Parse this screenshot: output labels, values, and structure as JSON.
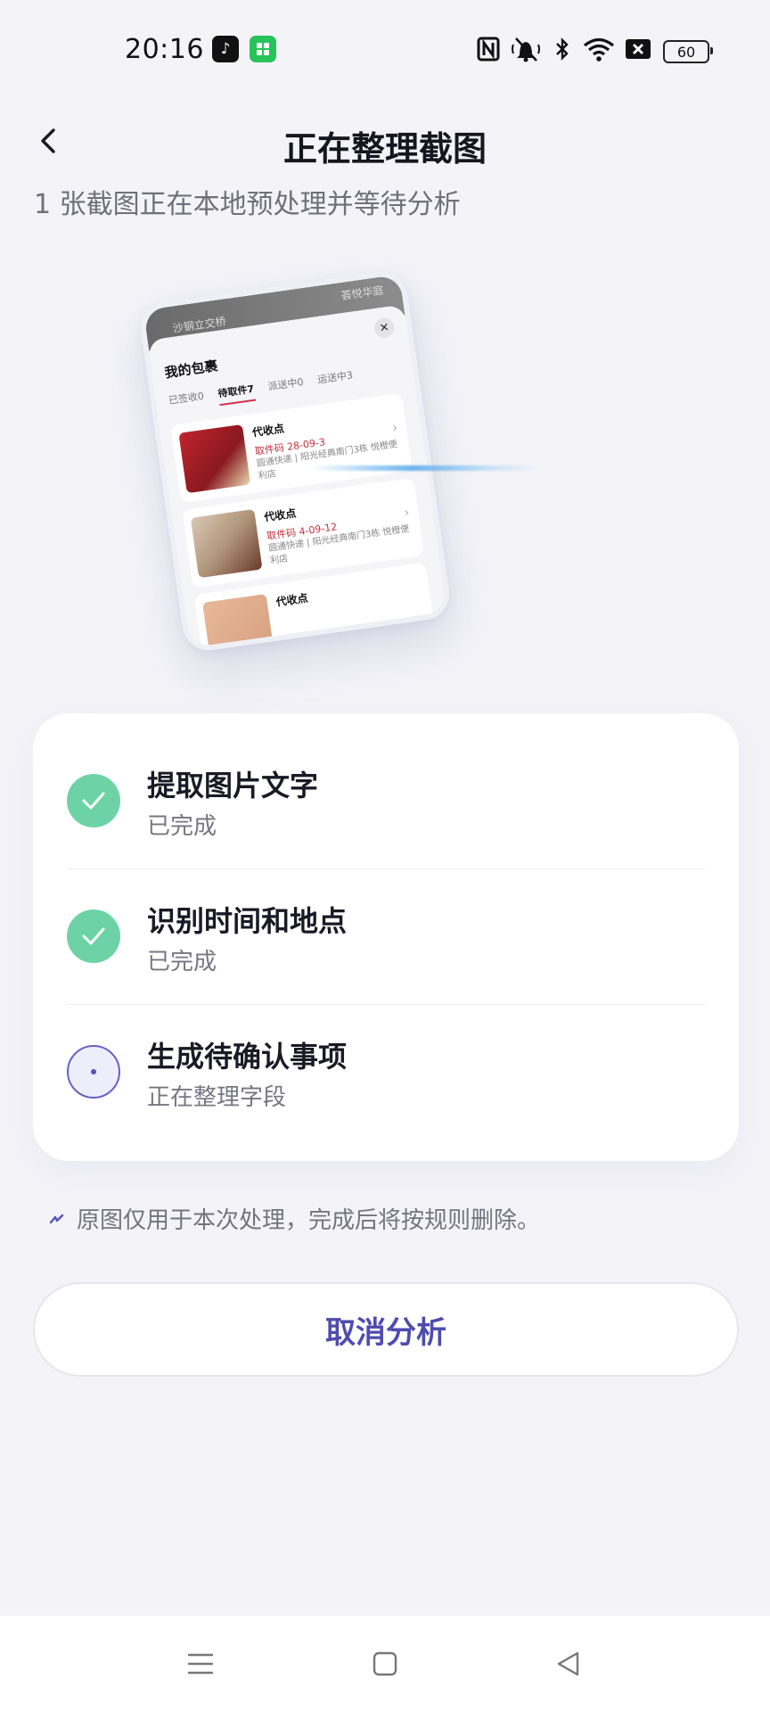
{
  "status_bar": {
    "time": "20:16",
    "battery": "60",
    "icons": [
      "tiktok-icon",
      "wechat-icon",
      "nfc-icon",
      "mute-icon",
      "bluetooth-icon",
      "wifi-icon",
      "close-box-icon",
      "battery-icon"
    ]
  },
  "header": {
    "title": "正在整理截图",
    "subtitle": "1 张截图正在本地预处理并等待分析"
  },
  "preview": {
    "top_left": "沙钢立交桥",
    "top_right": "荟悦华庭",
    "sheet_title": "我的包裹",
    "tabs": [
      "已签收0",
      "待取件7",
      "派送中0",
      "运送中3"
    ],
    "active_tab": 1,
    "items": [
      {
        "label": "代收点",
        "code": "取件码 28-09-3",
        "detail": "圆通快递 | 阳光经典南门3栋 悦橙便利店"
      },
      {
        "label": "代收点",
        "code": "取件码 4-09-12",
        "detail": "圆通快递 | 阳光经典南门3栋 悦橙便利店"
      },
      {
        "label": "代收点",
        "code": "",
        "detail": ""
      }
    ]
  },
  "steps": [
    {
      "name": "提取图片文字",
      "status": "已完成",
      "state": "done"
    },
    {
      "name": "识别时间和地点",
      "status": "已完成",
      "state": "done"
    },
    {
      "name": "生成待确认事项",
      "status": "正在整理字段",
      "state": "in-progress"
    }
  ],
  "note": "原图仅用于本次处理，完成后将按规则删除。",
  "cancel_label": "取消分析",
  "colors": {
    "background": "#f3f3f8",
    "accent": "#4f4cae",
    "done": "#6dd3a6",
    "pending_border": "#6663c4"
  }
}
